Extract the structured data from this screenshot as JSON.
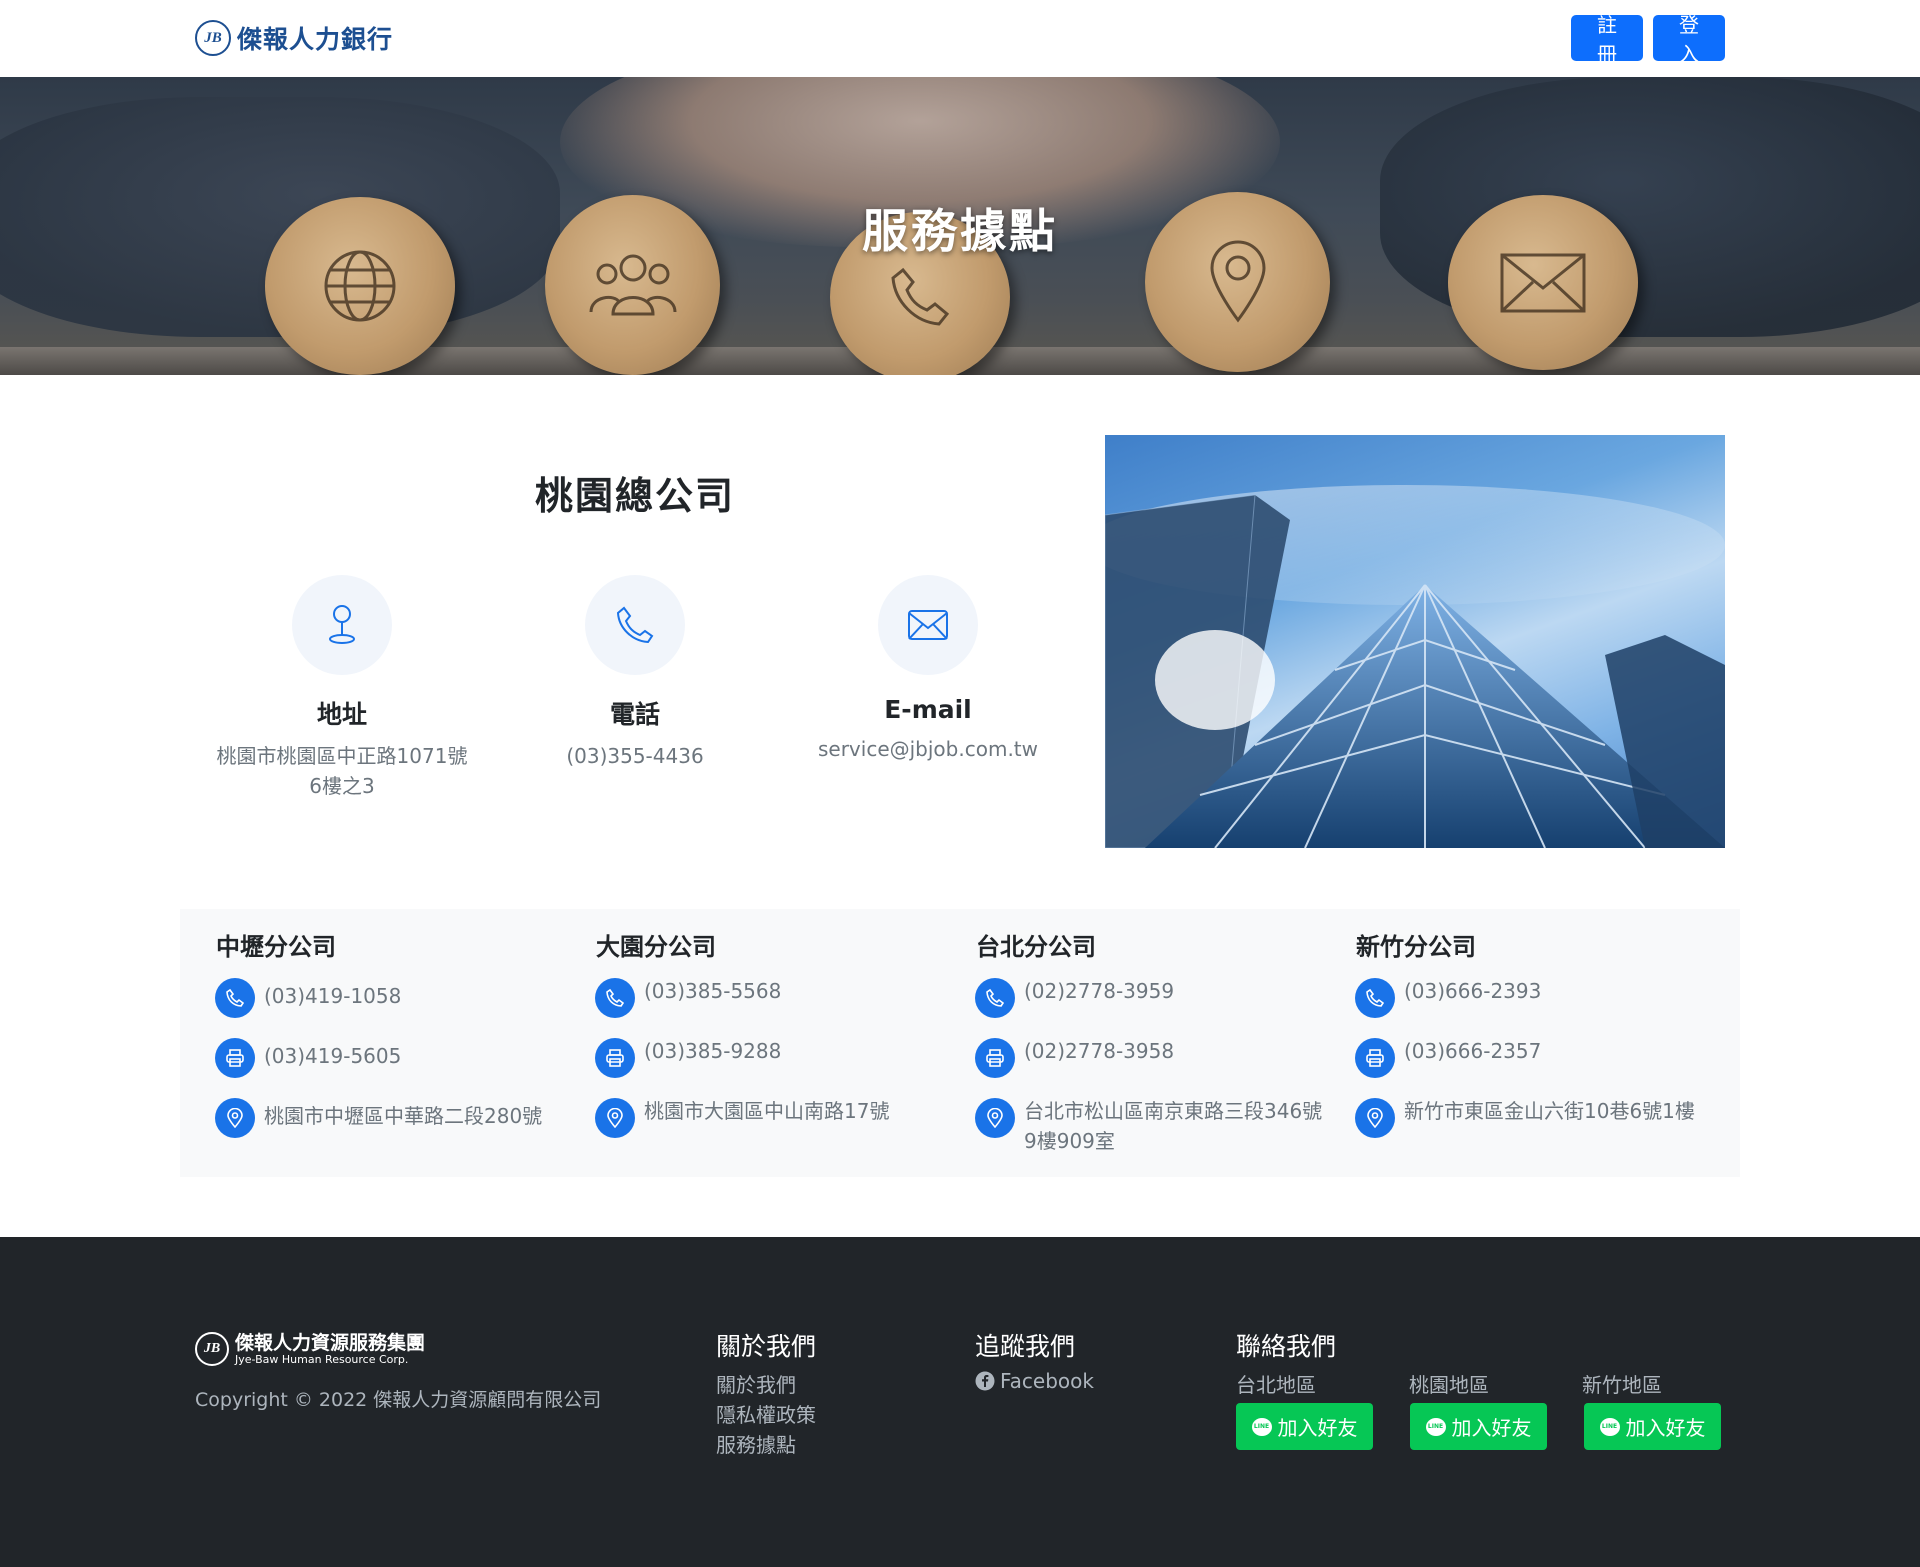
{
  "header": {
    "brand_name": "傑報人力銀行",
    "brand_mark": "JB",
    "register_label": "註冊",
    "login_label": "登入"
  },
  "hero": {
    "title": "服務據點"
  },
  "headquarters": {
    "title": "桃園總公司",
    "address_label": "地址",
    "address_value": "桃園市桃園區中正路1071號6樓之3",
    "phone_label": "電話",
    "phone_value": "(03)355-4436",
    "email_label": "E-mail",
    "email_value": "service@jbjob.com.tw"
  },
  "branches": [
    {
      "title": "中壢分公司",
      "phone": "(03)419-1058",
      "fax": "(03)419-5605",
      "address": "桃園市中壢區中華路二段280號"
    },
    {
      "title": "大園分公司",
      "phone": "(03)385-5568",
      "fax": "(03)385-9288",
      "address": "桃園市大園區中山南路17號"
    },
    {
      "title": "台北分公司",
      "phone": "(02)2778-3959",
      "fax": "(02)2778-3958",
      "address": "台北市松山區南京東路三段346號9樓909室"
    },
    {
      "title": "新竹分公司",
      "phone": "(03)666-2393",
      "fax": "(03)666-2357",
      "address": "新竹市東區金山六街10巷6號1樓"
    }
  ],
  "footer": {
    "logo_name": "傑報人力資源服務集團",
    "logo_sub": "Jye-Baw Human Resource Corp.",
    "copyright": "Copyright © 2022 傑報人力資源顧問有限公司",
    "about_heading": "關於我們",
    "about_links": [
      "關於我們",
      "隱私權政策",
      "服務據點"
    ],
    "follow_heading": "追蹤我們",
    "facebook_label": "Facebook",
    "contact_heading": "聯絡我們",
    "regions": [
      {
        "name": "台北地區",
        "button": "加入好友"
      },
      {
        "name": "桃園地區",
        "button": "加入好友"
      },
      {
        "name": "新竹地區",
        "button": "加入好友"
      }
    ],
    "line_mark": "LINE"
  },
  "colors": {
    "primary": "#0d6efd",
    "brand_blue": "#1d4f91",
    "icon_blue": "#1a73e8",
    "line_green": "#06c755",
    "footer_bg": "#212529",
    "branch_bg": "#f8f9fa"
  },
  "icons": {
    "hero_discs": [
      "globe-icon",
      "people-icon",
      "phone-icon",
      "location-pin-icon",
      "envelope-icon"
    ],
    "info": [
      "map-pin-icon",
      "phone-icon",
      "envelope-icon"
    ],
    "branch_rows": [
      "phone-icon",
      "printer-icon",
      "location-pin-icon"
    ],
    "footer": [
      "facebook-icon",
      "line-icon"
    ]
  }
}
